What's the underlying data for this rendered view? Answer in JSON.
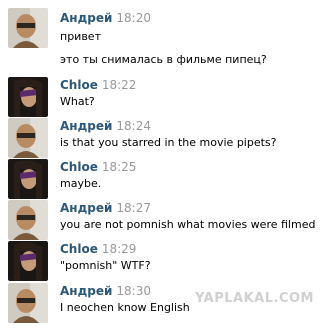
{
  "messages": [
    {
      "author": "Андрей",
      "time": "18:20",
      "lines": [
        "привет",
        "это ты снималась в фильме пипец?"
      ]
    },
    {
      "author": "Chloe",
      "time": "18:22",
      "lines": [
        "What?"
      ]
    },
    {
      "author": "Андрей",
      "time": "18:24",
      "lines": [
        "is that you starred in the movie pipets?"
      ]
    },
    {
      "author": "Chloe",
      "time": "18:25",
      "lines": [
        "maybe."
      ]
    },
    {
      "author": "Андрей",
      "time": "18:27",
      "lines": [
        "you are not pomnish what movies were filmed"
      ]
    },
    {
      "author": "Chloe",
      "time": "18:29",
      "lines": [
        "\"pomnish\" WTF?"
      ]
    },
    {
      "author": "Андрей",
      "time": "18:30",
      "lines": [
        "I neochen know English"
      ]
    }
  ],
  "watermark": "YAPLAKAL.COM",
  "colors": {
    "author": "#2b587a",
    "time": "#999999",
    "background": "#ffffff"
  }
}
